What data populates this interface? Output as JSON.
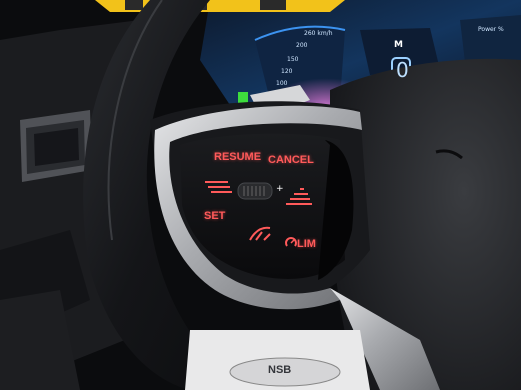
{
  "image_kind": "photograph of a steering wheel cruise-control button pad",
  "buttons": {
    "resume": "RESUME",
    "cancel": "CANCEL",
    "set": "SET",
    "limiter": "LIM"
  },
  "cluster": {
    "speed_scale": [
      "260 km/h",
      "200",
      "150",
      "120",
      "100"
    ],
    "gear_readout": "0",
    "brand": "M",
    "power_label": "Power %"
  },
  "plaque": {
    "text": "NSB"
  },
  "icons": [
    "distance-minus-icon",
    "distance-plus-icon",
    "speed-rocker-icon",
    "lane-assist-icon",
    "limiter-icon",
    "paddle-shifter-icon"
  ],
  "colors": {
    "button_glow": "#ff5a5a",
    "cluster_blue": "#2a7bd6",
    "cluster_pink": "#d86bd0",
    "trim_silver": "#b9bbbf",
    "leather_black": "#131416",
    "top_sticker_yellow": "#f2c21a"
  }
}
